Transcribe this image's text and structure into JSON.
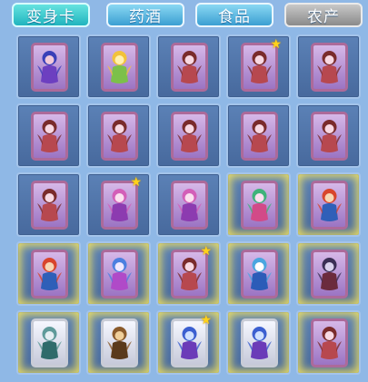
{
  "tabs": [
    {
      "label": "变身卡",
      "state": "active"
    },
    {
      "label": "药酒",
      "state": "normal"
    },
    {
      "label": "食品",
      "state": "normal"
    },
    {
      "label": "农产",
      "state": "disabled"
    }
  ],
  "colors": {
    "background": "#8fb8e6",
    "slot": "#527aad",
    "active_tab": "#2ec0c8",
    "tab": "#4aaee0",
    "star": "#ffd21a"
  },
  "slots": [
    {
      "character": "blue-imp",
      "card_color": "purple",
      "glow": false,
      "star": false
    },
    {
      "character": "yellow-pumpkin-ghost",
      "card_color": "purple",
      "glow": false,
      "star": false
    },
    {
      "character": "red-winged-dancer",
      "card_color": "purple",
      "glow": false,
      "star": false
    },
    {
      "character": "red-winged-dancer",
      "card_color": "purple",
      "glow": false,
      "star": true
    },
    {
      "character": "red-winged-dancer",
      "card_color": "purple",
      "glow": false,
      "star": false
    },
    {
      "character": "red-winged-dancer",
      "card_color": "purple",
      "glow": false,
      "star": false
    },
    {
      "character": "red-winged-dancer",
      "card_color": "purple",
      "glow": false,
      "star": false
    },
    {
      "character": "red-winged-dancer",
      "card_color": "purple",
      "glow": false,
      "star": false
    },
    {
      "character": "red-winged-dancer",
      "card_color": "purple",
      "glow": false,
      "star": false
    },
    {
      "character": "red-winged-dancer",
      "card_color": "purple",
      "glow": false,
      "star": false
    },
    {
      "character": "red-winged-dancer",
      "card_color": "purple",
      "glow": false,
      "star": false
    },
    {
      "character": "pink-fairy",
      "card_color": "purple",
      "glow": false,
      "star": true
    },
    {
      "character": "pink-fairy",
      "card_color": "purple",
      "glow": false,
      "star": false
    },
    {
      "character": "green-haired-dancer",
      "card_color": "purple",
      "glow": true,
      "star": false
    },
    {
      "character": "red-warrior",
      "card_color": "purple",
      "glow": true,
      "star": false
    },
    {
      "character": "red-warrior",
      "card_color": "purple",
      "glow": true,
      "star": false
    },
    {
      "character": "blue-fox-spirit",
      "card_color": "purple",
      "glow": true,
      "star": false
    },
    {
      "character": "red-winged-dancer",
      "card_color": "purple",
      "glow": true,
      "star": true
    },
    {
      "character": "blue-bear",
      "card_color": "purple",
      "glow": true,
      "star": false
    },
    {
      "character": "dark-armored-knight",
      "card_color": "purple",
      "glow": true,
      "star": false
    },
    {
      "character": "silver-dragon",
      "card_color": "white",
      "glow": true,
      "star": false
    },
    {
      "character": "brown-lion-warrior",
      "card_color": "white",
      "glow": true,
      "star": false
    },
    {
      "character": "blue-wolf-beast",
      "card_color": "white",
      "glow": true,
      "star": true
    },
    {
      "character": "blue-wolf-beast",
      "card_color": "white",
      "glow": true,
      "star": false
    },
    {
      "character": "red-winged-dancer",
      "card_color": "purple",
      "glow": true,
      "star": false
    }
  ]
}
